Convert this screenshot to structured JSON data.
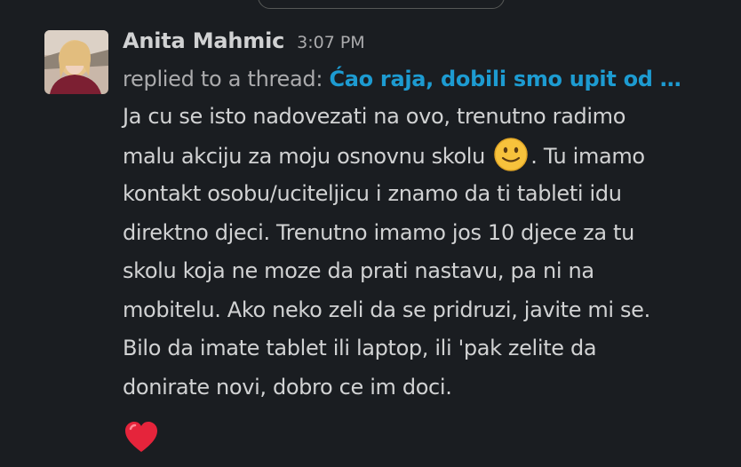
{
  "message": {
    "sender_name": "Anita Mahmic",
    "timestamp": "3:07 PM",
    "thread_prefix": "replied to a thread:",
    "thread_link_text": "Ćao raja, dobili smo upit od …",
    "body_lines": [
      "Ja cu se isto nadovezati na ovo, trenutno radimo",
      "malu akciju za moju osnovnu skolu",
      ". Tu imamo",
      "kontakt osobu/uciteljicu i znamo da ti tableti idu",
      "direktno djeci. Trenutno imamo jos 10 djece za tu",
      "skolu koja ne moze da prati nastavu, pa ni na",
      "mobitelu. Ako neko zeli da se pridruzi, javite mi se.",
      "Bilo da imate tablet ili laptop, ili 'pak zelite da",
      "donirate novi, dobro ce im doci."
    ],
    "inline_emoji": "slightly-smiling-face-icon",
    "trailing_emoji": "red-heart-icon"
  },
  "colors": {
    "background": "#1a1d21",
    "text": "#d1d2d3",
    "muted": "#ababad",
    "link": "#1d9bd1"
  }
}
